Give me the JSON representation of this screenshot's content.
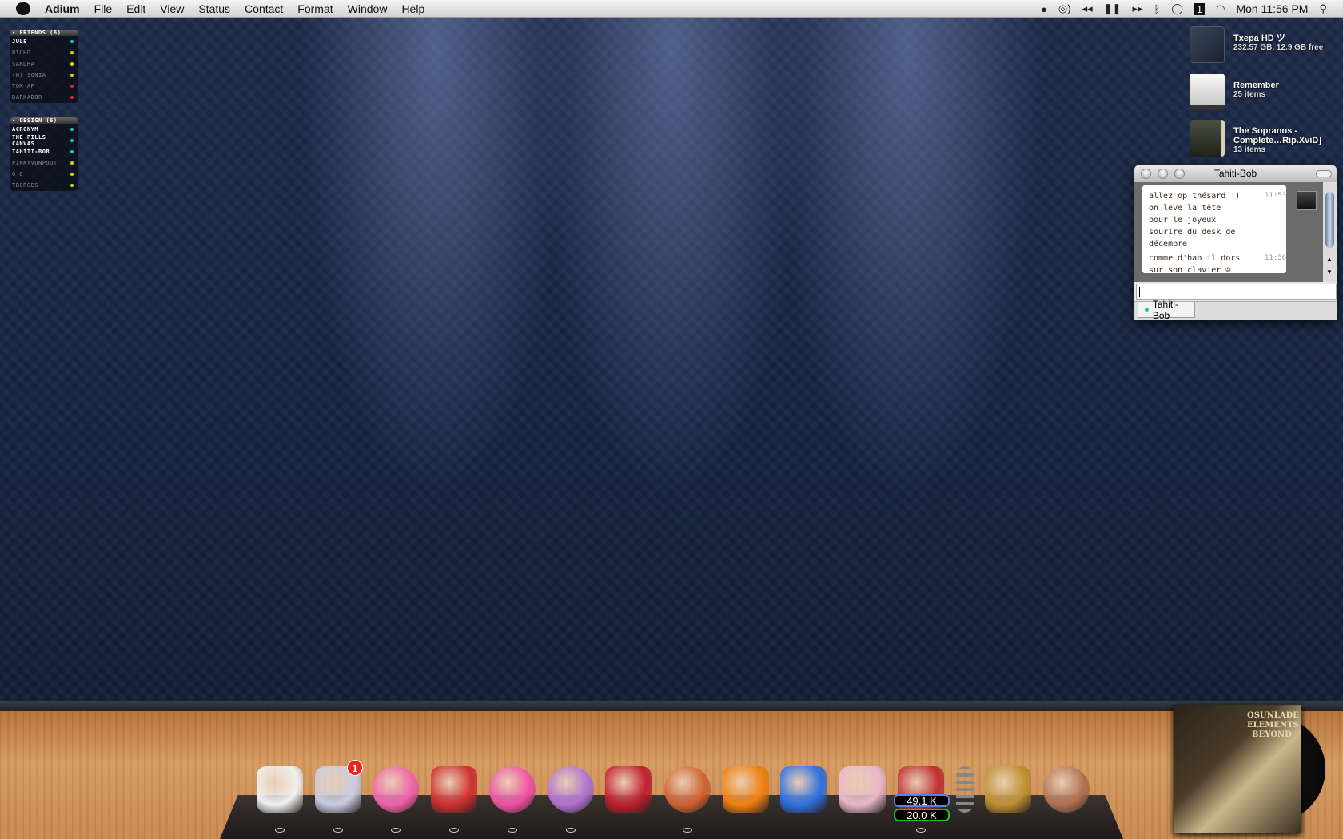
{
  "menubar": {
    "app": "Adium",
    "items": [
      "File",
      "Edit",
      "View",
      "Status",
      "Contact",
      "Format",
      "Window",
      "Help"
    ],
    "clock": "Mon 11:56 PM",
    "status_icons": [
      "adium-speech-icon",
      "itunes-icon",
      "rewind-icon",
      "pause-icon",
      "fast-forward-icon",
      "bluetooth-icon",
      "chat-bubble-icon",
      "spaces-icon",
      "wifi-icon"
    ],
    "spaces_number": "1"
  },
  "contact_list": {
    "groups": [
      {
        "name": "FRIENDS (6)",
        "contacts": [
          {
            "name": "JULE",
            "status": "online",
            "color": "#1ec8b8"
          },
          {
            "name": "BICHO",
            "status": "away",
            "color": "#d8d020"
          },
          {
            "name": "SANDRA",
            "status": "away",
            "color": "#d8d020"
          },
          {
            "name": "(W) SONIA",
            "status": "away",
            "color": "#d8d020"
          },
          {
            "name": "TOM AP",
            "status": "busy",
            "color": "#e02040"
          },
          {
            "name": "DARKADOR",
            "status": "busy",
            "color": "#e02040"
          }
        ]
      },
      {
        "name": "DESIGN (6)",
        "contacts": [
          {
            "name": "ACRONYM",
            "status": "online",
            "color": "#1ec8b8"
          },
          {
            "name": "THE PILLS CANVAS",
            "status": "online",
            "color": "#1ec8b8"
          },
          {
            "name": "TAHITI-BOB",
            "status": "online",
            "color": "#1ec8b8"
          },
          {
            "name": "PINKYVONPOUT",
            "status": "away",
            "color": "#d8d020"
          },
          {
            "name": " O_O",
            "status": "away",
            "color": "#d8d020"
          },
          {
            "name": "TBORGES",
            "status": "away",
            "color": "#d8d020"
          }
        ]
      }
    ]
  },
  "desktop": [
    {
      "name": "Txepa HD ツ ",
      "info": "232.57 GB, 12.9 GB free"
    },
    {
      "name": "Remember",
      "info": "25 items"
    },
    {
      "name": "The Sopranos - Complete…Rip.XviD]",
      "info": "13 items"
    }
  ],
  "chat": {
    "title": "Tahiti-Bob",
    "messages": [
      {
        "text": "allez op thésard  !! on lève la tête pour le joyeux sourire du desk de décembre",
        "time": "11:53"
      },
      {
        "text": "comme d'hab il dors sur son clavier",
        "time": "11:56"
      }
    ],
    "input_value": "",
    "tab_label": "Tahiti-Bob"
  },
  "dock": {
    "items": [
      {
        "name": "finder-house",
        "color": "#f0f0f0"
      },
      {
        "name": "mail-mailbox",
        "color": "#c8cbe0",
        "badge": "1"
      },
      {
        "name": "donut",
        "color": "#f060a8"
      },
      {
        "name": "adium-duck",
        "color": "#d03030"
      },
      {
        "name": "ichat",
        "color": "#f050a0"
      },
      {
        "name": "itunes",
        "color": "#b070d0"
      },
      {
        "name": "address-book",
        "color": "#c02030"
      },
      {
        "name": "cookies",
        "color": "#d06030"
      },
      {
        "name": "vlc",
        "color": "#f08010"
      },
      {
        "name": "candybar",
        "color": "#3070e0"
      },
      {
        "name": "transmit-truck",
        "color": "#e8b8c8"
      },
      {
        "name": "activity-monitor",
        "color": "#c03030"
      },
      {
        "name": "stack",
        "color": "#777"
      },
      {
        "name": "downloads-box",
        "color": "#c09030"
      },
      {
        "name": "trash-rat",
        "color": "#b07050"
      }
    ],
    "net_in": "49.1 K",
    "net_out": "20.0 K"
  },
  "now_playing": {
    "artist": "OSUNLADE",
    "album": "ELEMENTS BEYOND"
  }
}
